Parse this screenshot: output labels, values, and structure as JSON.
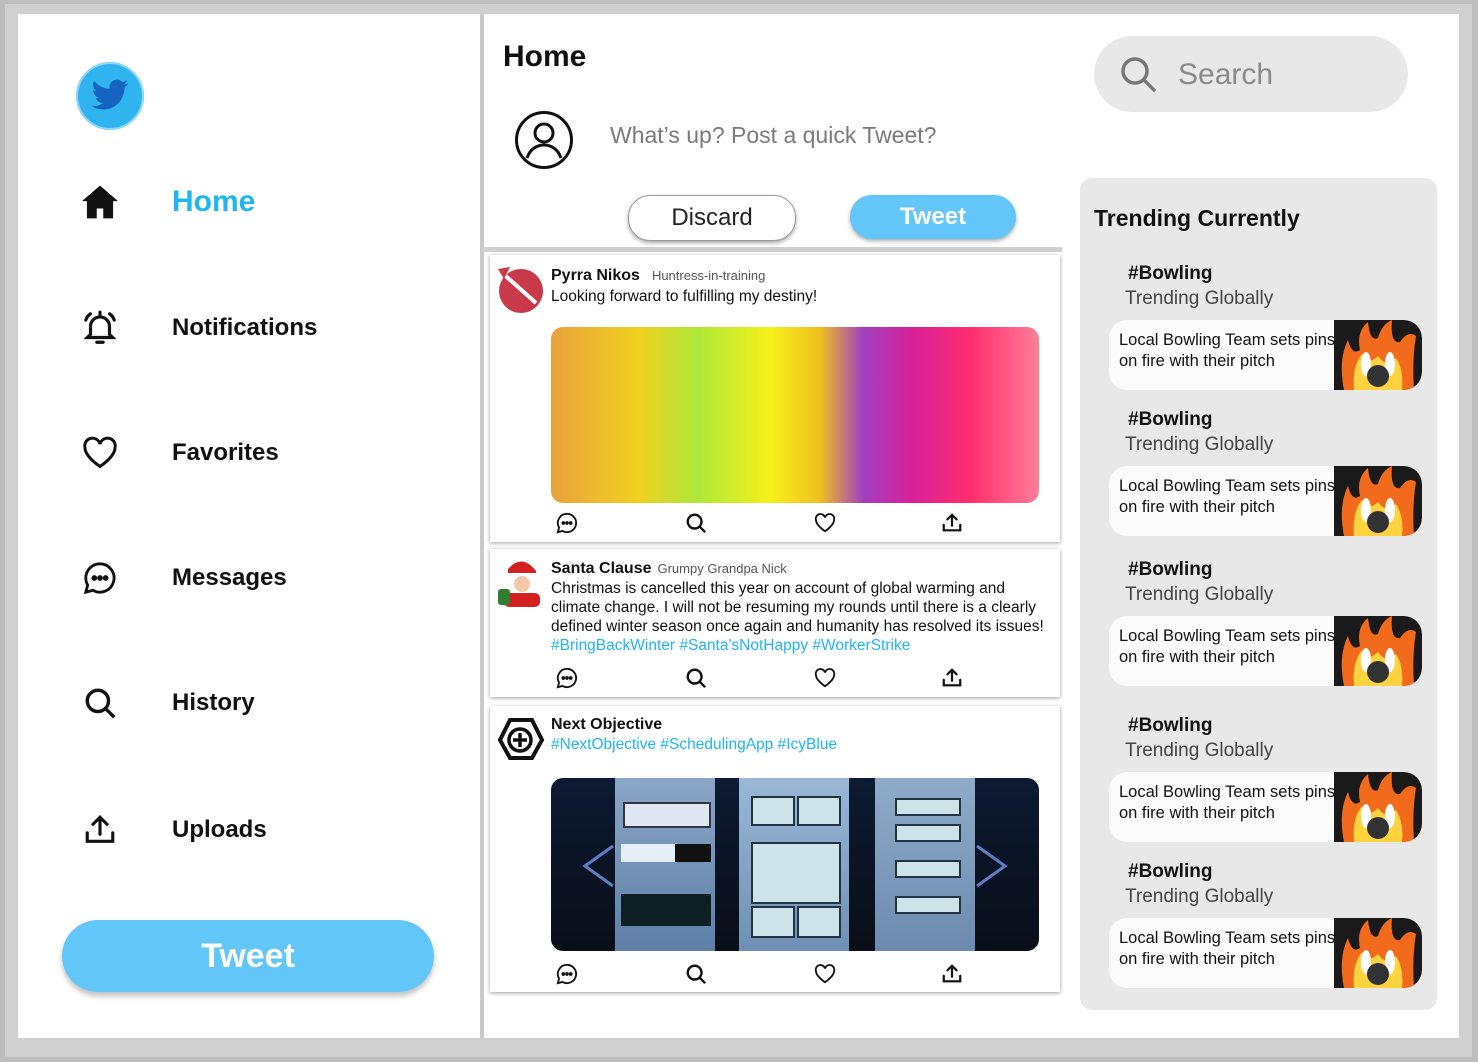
{
  "sidebar": {
    "logo": "twitter-bird-icon",
    "items": [
      {
        "label": "Home",
        "icon": "home-icon",
        "active": true
      },
      {
        "label": "Notifications",
        "icon": "bell-icon",
        "active": false
      },
      {
        "label": "Favorites",
        "icon": "heart-icon",
        "active": false
      },
      {
        "label": "Messages",
        "icon": "chat-bubble-icon",
        "active": false
      },
      {
        "label": "History",
        "icon": "search-icon",
        "active": false
      },
      {
        "label": "Uploads",
        "icon": "upload-icon",
        "active": false
      }
    ],
    "tweet_label": "Tweet"
  },
  "main": {
    "title": "Home",
    "compose": {
      "placeholder": "What’s up? Post a quick Tweet?",
      "discard_label": "Discard",
      "tweet_label": "Tweet"
    },
    "posts": [
      {
        "name": "Pyrra Nikos",
        "handle": "Huntress-in-training",
        "text": "Looking forward to fulfilling my destiny!",
        "hashtags": "",
        "media": "colorful-paint-explosion-image"
      },
      {
        "name": "Santa Clause",
        "handle": "Grumpy Grandpa Nick",
        "text": "Christmas is cancelled this year on account of global warming and climate change. I will not be resuming my rounds until there is a clearly defined winter season once again and humanity has resolved its issues!",
        "hashtags": "#BringBackWinter #Santa'sNotHappy #WorkerStrike",
        "media": ""
      },
      {
        "name": "Next Objective",
        "handle": "",
        "text": "",
        "hashtags": "#NextObjective #SchedulingApp #IcyBlue",
        "media": "scheduling-app-screens-image"
      }
    ]
  },
  "right": {
    "search_placeholder": "Search",
    "trending_title": "Trending Currently",
    "trends": [
      {
        "tag": "#Bowling",
        "sub": "Trending Globally",
        "headline": "Local Bowling Team sets pins on fire with their pitch"
      },
      {
        "tag": "#Bowling",
        "sub": "Trending Globally",
        "headline": "Local Bowling Team sets pins on fire with their pitch"
      },
      {
        "tag": "#Bowling",
        "sub": "Trending Globally",
        "headline": "Local Bowling Team sets pins on fire with their pitch"
      },
      {
        "tag": "#Bowling",
        "sub": "Trending Globally",
        "headline": "Local Bowling Team sets pins on fire with their pitch"
      },
      {
        "tag": "#Bowling",
        "sub": "Trending Globally",
        "headline": "Local Bowling Team sets pins on fire with their pitch"
      }
    ]
  },
  "colors": {
    "accent": "#1fb6f0",
    "button": "#62c6f8",
    "panel": "#e8e8e8"
  }
}
